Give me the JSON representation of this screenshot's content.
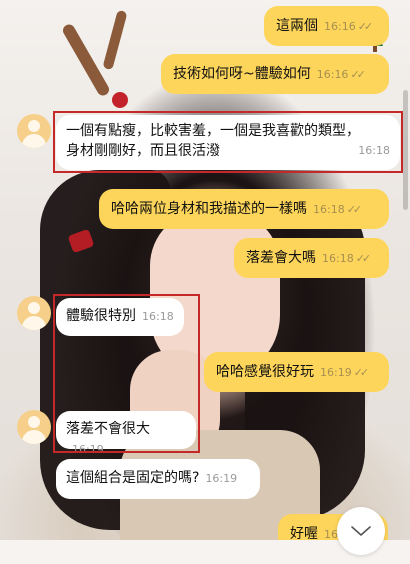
{
  "messages": [
    {
      "id": "m1",
      "direction": "out",
      "text": "這兩個",
      "time": "16:16"
    },
    {
      "id": "m2",
      "direction": "out",
      "text": "技術如何呀~體驗如何",
      "time": "16:16"
    },
    {
      "id": "m3",
      "direction": "in",
      "line1": "一個有點瘦，比較害羞，一個是我喜歡的類型，",
      "line2": "身材剛剛好，而且很活潑",
      "time": "16:18"
    },
    {
      "id": "m4",
      "direction": "out",
      "text": "哈哈兩位身材和我描述的一樣嗎",
      "time": "16:18"
    },
    {
      "id": "m5",
      "direction": "out",
      "text": "落差會大嗎",
      "time": "16:18"
    },
    {
      "id": "m6",
      "direction": "in",
      "text": "體驗很特別",
      "time": "16:18"
    },
    {
      "id": "m7",
      "direction": "out",
      "text": "哈哈感覺很好玩",
      "time": "16:19"
    },
    {
      "id": "m8",
      "direction": "in",
      "text": "落差不會很大",
      "time": "16:19"
    },
    {
      "id": "m9",
      "direction": "in",
      "text": "這個組合是固定的嗎?",
      "time": "16:19"
    },
    {
      "id": "m10",
      "direction": "out",
      "text": "好喔",
      "time": "16"
    }
  ],
  "read_mark": "✓✓",
  "icons": {
    "avatar": "user-avatar-icon",
    "scroll": "chevron-down-icon"
  },
  "colors": {
    "outgoing_bubble": "#fdd55a",
    "incoming_bubble": "#ffffff",
    "highlight_border": "#c42828",
    "avatar_bg": "#f6d08a"
  }
}
